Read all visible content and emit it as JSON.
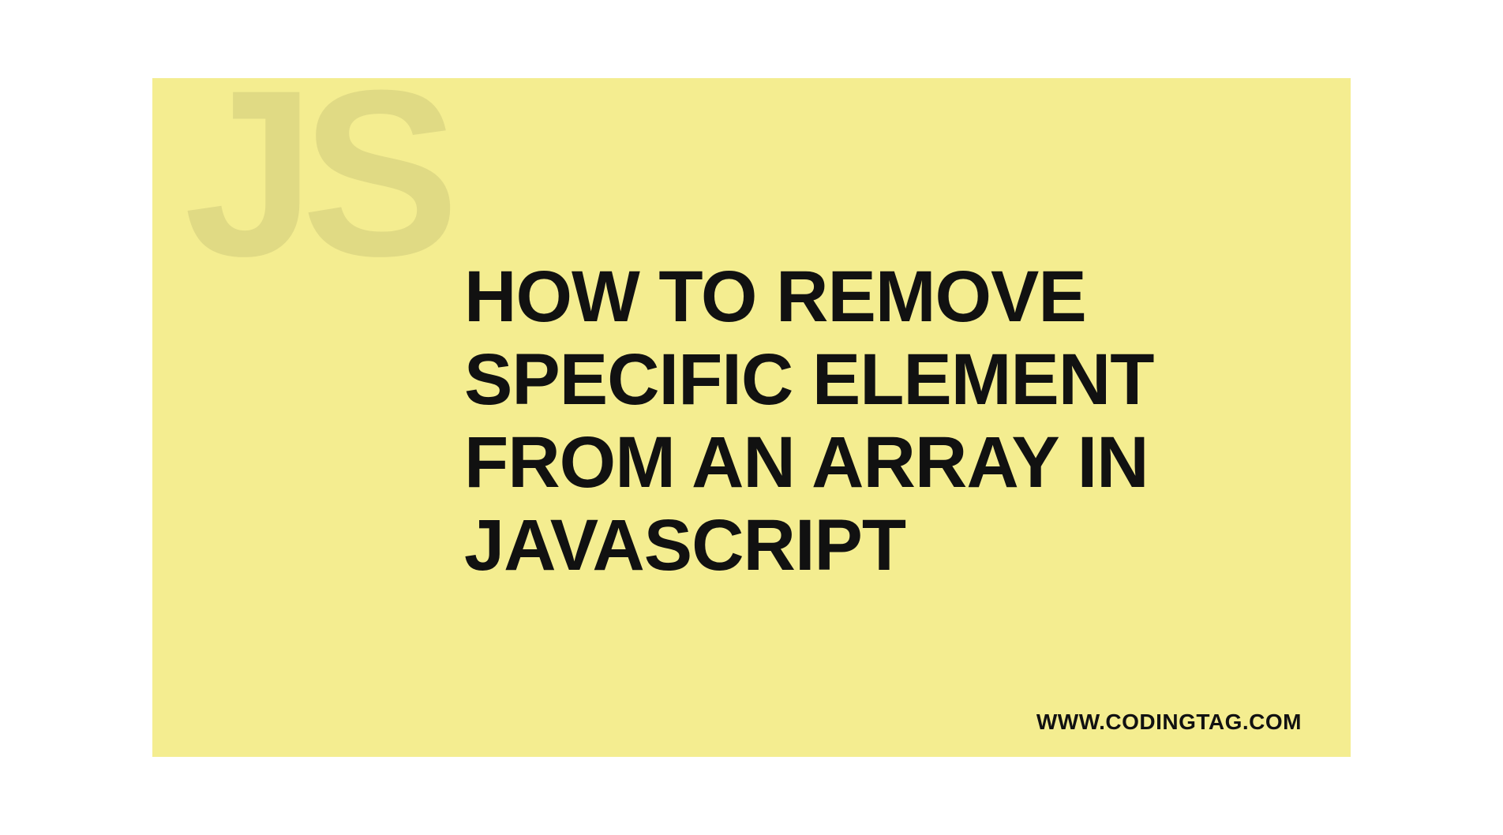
{
  "watermark": "JS",
  "headline": "HOW TO REMOVE SPECIFIC ELEMENT FROM AN ARRAY IN JAVASCRIPT",
  "site_url": "WWW.CODINGTAG.COM"
}
